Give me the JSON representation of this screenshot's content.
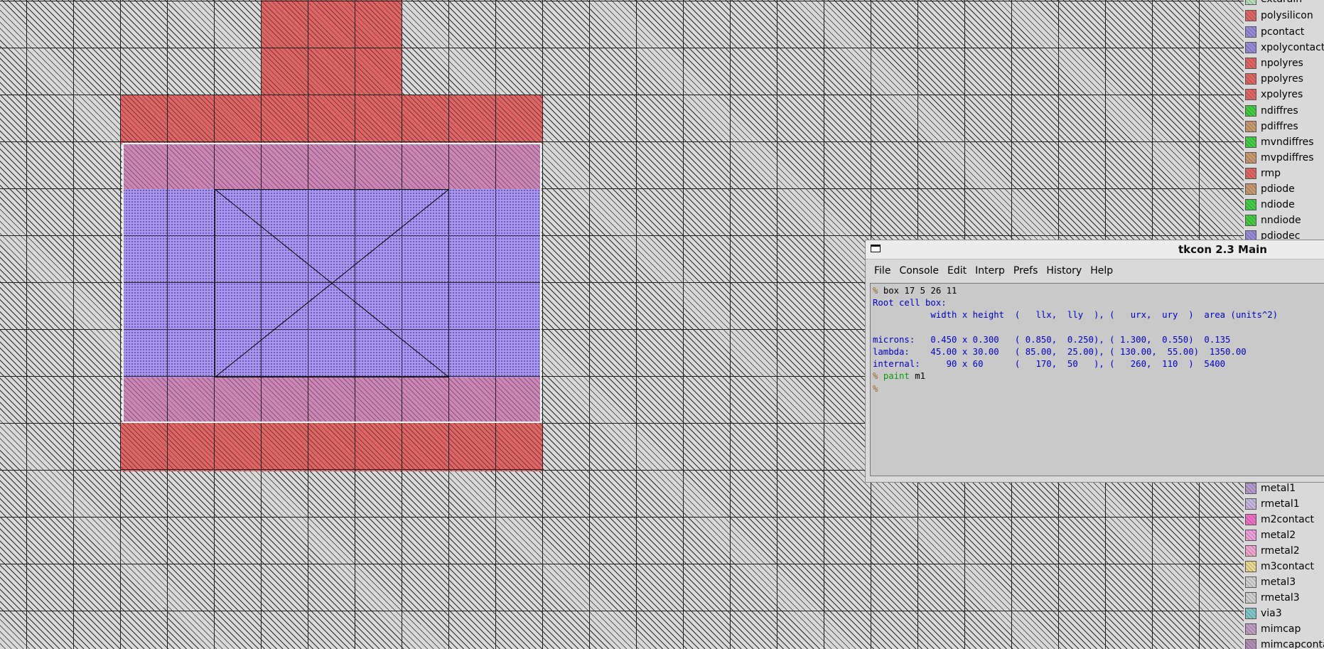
{
  "palette": {
    "items": [
      {
        "label": "extdrain",
        "color": "#b8e0b8"
      },
      {
        "label": "polysilicon",
        "color": "#e06666"
      },
      {
        "label": "pcontact",
        "color": "#9a8ad8"
      },
      {
        "label": "xpolycontact",
        "color": "#9a8ad8"
      },
      {
        "label": "npolyres",
        "color": "#e06666"
      },
      {
        "label": "ppolyres",
        "color": "#e06666"
      },
      {
        "label": "xpolyres",
        "color": "#e06666"
      },
      {
        "label": "ndiffres",
        "color": "#44cc44"
      },
      {
        "label": "pdiffres",
        "color": "#c89a70"
      },
      {
        "label": "mvndiffres",
        "color": "#44cc44"
      },
      {
        "label": "mvpdiffres",
        "color": "#c89a70"
      },
      {
        "label": "rmp",
        "color": "#e06666"
      },
      {
        "label": "pdiode",
        "color": "#c89a70"
      },
      {
        "label": "ndiode",
        "color": "#44cc44"
      },
      {
        "label": "nndiode",
        "color": "#44cc44"
      },
      {
        "label": "pdiodec",
        "color": "#9a8ad8"
      },
      {
        "label": "metal1",
        "color": "#b59ccc"
      },
      {
        "label": "rmetal1",
        "color": "#c8b6dc"
      },
      {
        "label": "m2contact",
        "color": "#f070c8"
      },
      {
        "label": "metal2",
        "color": "#f0a0d8"
      },
      {
        "label": "rmetal2",
        "color": "#f0a8d0"
      },
      {
        "label": "m3contact",
        "color": "#e8d890"
      },
      {
        "label": "metal3",
        "color": "#d0d0d0"
      },
      {
        "label": "rmetal3",
        "color": "#d0d0d0"
      },
      {
        "label": "via3",
        "color": "#80c8c8"
      },
      {
        "label": "mimcap",
        "color": "#c0a0c0"
      },
      {
        "label": "mimcapconta",
        "color": "#b090b0"
      }
    ]
  },
  "tkcon": {
    "title": "tkcon 2.3 Main",
    "menus": [
      "File",
      "Console",
      "Edit",
      "Interp",
      "Prefs",
      "History",
      "Help"
    ],
    "prompt": "%",
    "cmd1": "box 17 5 26 11",
    "out1": "Root cell box:",
    "out2": "           width x height  (   llx,  lly  ), (   urx,  ury  )  area (units^2)",
    "out3": "",
    "out4": "microns:   0.450 x 0.300   ( 0.850,  0.250), ( 1.300,  0.550)  0.135",
    "out5": "lambda:    45.00 x 30.00   ( 85.00,  25.00), ( 130.00,  55.00)  1350.00",
    "out6": "internal:     90 x 60      (   170,  50   ), (   260,  110  )  5400",
    "cmd2_verb": "paint",
    "cmd2_arg": " m1"
  }
}
